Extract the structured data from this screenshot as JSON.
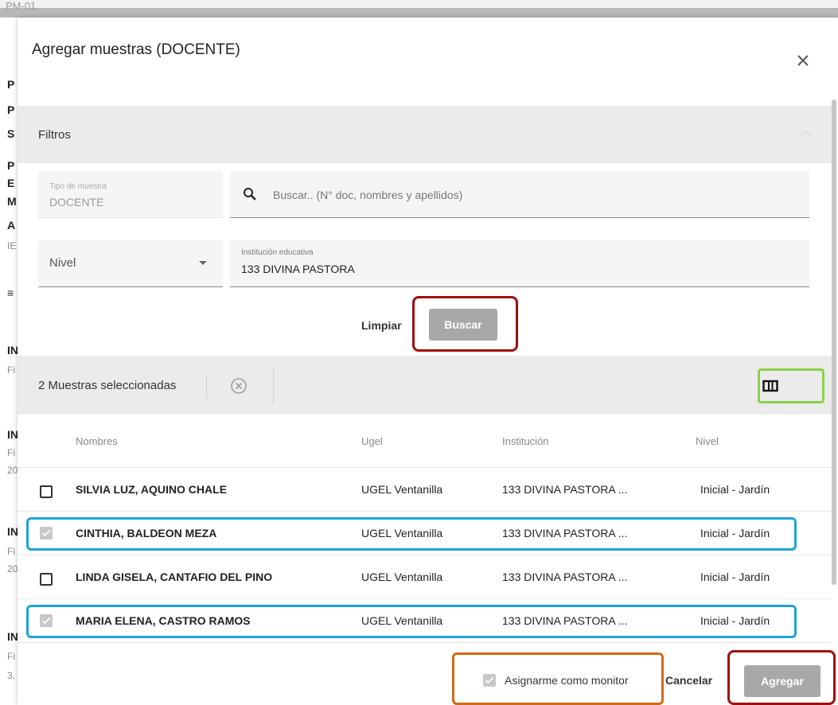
{
  "background": {
    "page_id": "PM-01",
    "side_letters": [
      "P",
      "P",
      "S",
      "P",
      "E",
      "M",
      "A",
      "IE",
      "≡",
      "IN",
      "Fi",
      "IN",
      "Fi",
      "20",
      "IN",
      "Fi",
      "20",
      "IN",
      "Fi",
      "3."
    ]
  },
  "dialog": {
    "title": "Agregar muestras (DOCENTE)",
    "close_icon": "close-icon"
  },
  "filters": {
    "header": "Filtros",
    "tipo_label": "Tipo de muestra",
    "tipo_value": "DOCENTE",
    "search_placeholder": "Buscar.. (N° doc, nombres y apellidos)",
    "nivel_value": "Nivel",
    "institucion_label": "Institución educativa",
    "institucion_value": "133 DIVINA PASTORA",
    "clear_label": "Limpiar",
    "search_label": "Buscar"
  },
  "selection": {
    "count_text": "2 Muestras seleccionadas"
  },
  "table": {
    "headers": [
      "Nombres",
      "Ugel",
      "Institución",
      "Nivel"
    ],
    "rows": [
      {
        "nombre": "SILVIA LUZ, AQUINO CHALE",
        "ugel": "UGEL Ventanilla",
        "institucion": "133 DIVINA PASTORA ...",
        "nivel": "Inicial - Jardín",
        "checked": false
      },
      {
        "nombre": "CINTHIA, BALDEON MEZA",
        "ugel": "UGEL Ventanilla",
        "institucion": "133 DIVINA PASTORA ...",
        "nivel": "Inicial - Jardín",
        "checked": true
      },
      {
        "nombre": "LINDA GISELA, CANTAFIO DEL PINO",
        "ugel": "UGEL Ventanilla",
        "institucion": "133 DIVINA PASTORA ...",
        "nivel": "Inicial - Jardín",
        "checked": false
      },
      {
        "nombre": "MARIA ELENA, CASTRO RAMOS",
        "ugel": "UGEL Ventanilla",
        "institucion": "133 DIVINA PASTORA ...",
        "nivel": "Inicial - Jardín",
        "checked": true
      }
    ]
  },
  "footer": {
    "monitor_label": "Asignarme como monitor",
    "monitor_checked": true,
    "cancel_label": "Cancelar",
    "add_label": "Agregar"
  },
  "colors": {
    "highlight_red": "#a00e0e",
    "highlight_blue": "#1ea3d8",
    "highlight_green": "#8bd14a",
    "highlight_orange": "#cf6b14",
    "button_disabled": "#a8a8a8"
  }
}
